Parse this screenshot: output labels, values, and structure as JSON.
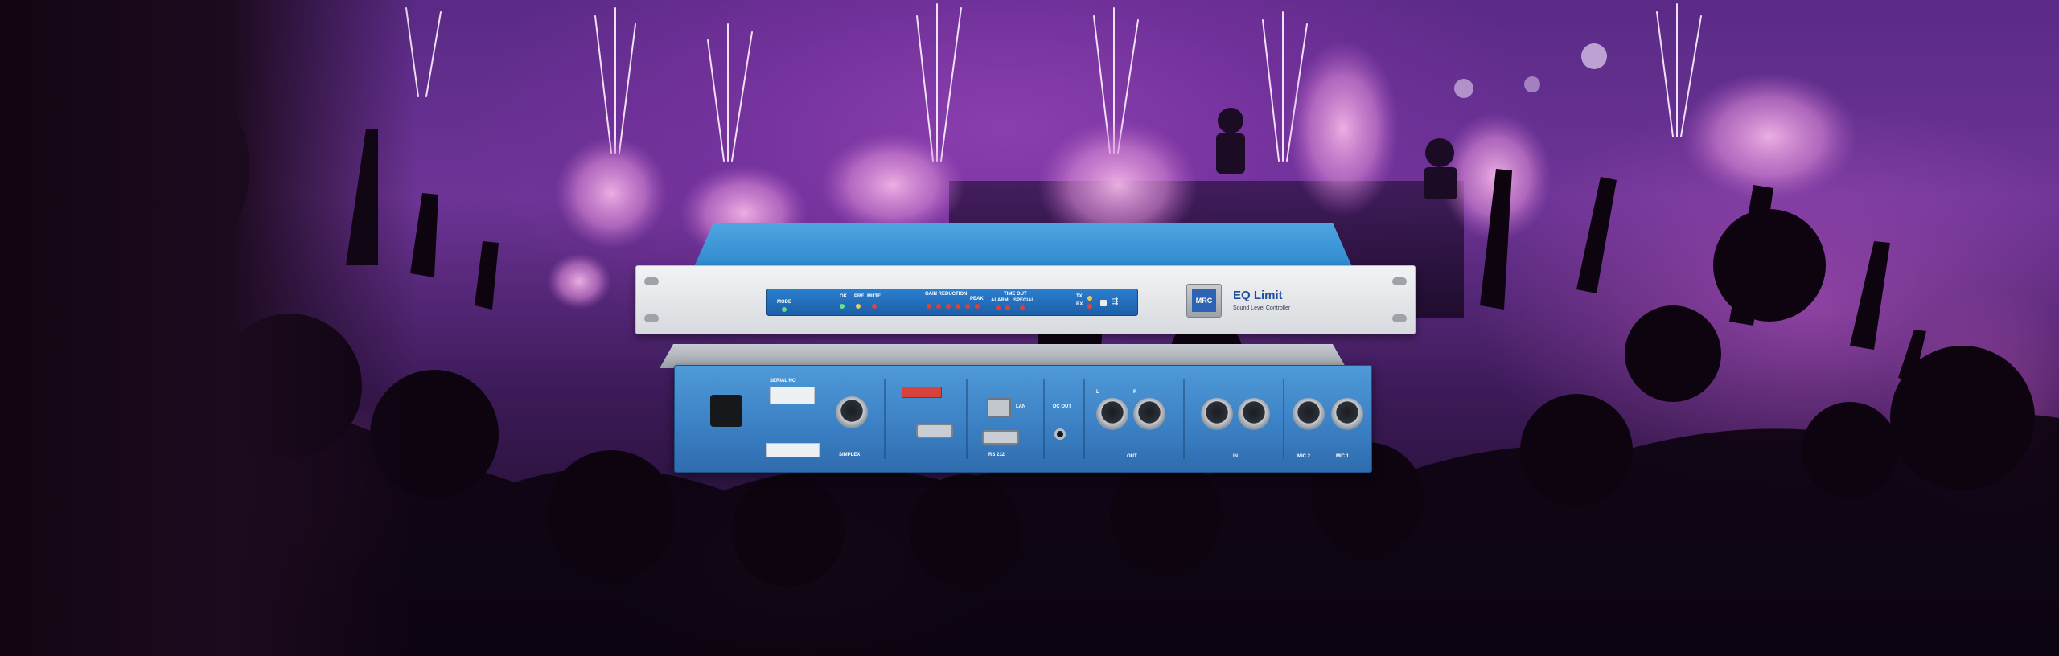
{
  "image": {
    "subject": "audio-rack-device-over-concert-crowd",
    "colors": {
      "background": "#5a2a86",
      "device_blue": "#2f88cf",
      "panel_silver": "#e4e6e9",
      "pink_glow": "#e06fd0"
    }
  },
  "front": {
    "brand": "EQ Limit",
    "sub": "Sound Level Controller",
    "logo": "MRC",
    "labels": {
      "mode": "MODE",
      "ok": "OK",
      "pre": "PRE",
      "mute": "MUTE",
      "gain_reduction": "GAIN REDUCTION",
      "peak": "PEAK",
      "time_out": "TIME OUT",
      "alarm": "ALARM",
      "special": "SPECIAL",
      "tx": "TX",
      "rx": "RX"
    }
  },
  "back": {
    "labels": {
      "serial": "SERIAL NO",
      "simplex": "SIMPLEX",
      "rs232": "RS 232",
      "lan": "LAN",
      "dc_out": "DC OUT",
      "out": "OUT",
      "in": "IN",
      "mic2": "MIC 2",
      "mic1": "MIC 1",
      "l": "L",
      "r": "R"
    }
  }
}
